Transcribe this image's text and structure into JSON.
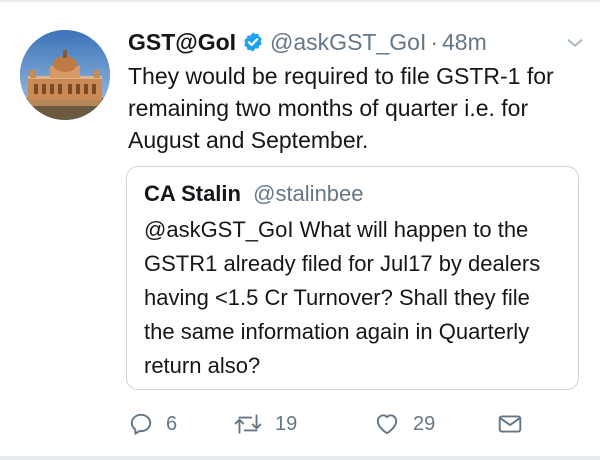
{
  "tweet": {
    "display_name": "GST@GoI",
    "handle": "@askGST_GoI",
    "separator": "·",
    "time": "48m",
    "text": "They would be required to file GSTR-1 for remaining two months of quarter i.e. for August and September.",
    "verified": true
  },
  "quoted_tweet": {
    "display_name": "CA Stalin",
    "handle": "@stalinbee",
    "text": "@askGST_GoI What will happen to the GSTR1 already filed for Jul17 by dealers having <1.5 Cr Turnover? Shall they file the same information again in Quarterly return also?"
  },
  "actions": {
    "reply": {
      "icon": "reply-icon",
      "count": "6"
    },
    "retweet": {
      "icon": "retweet-icon",
      "count": "19"
    },
    "like": {
      "icon": "heart-icon",
      "count": "29"
    },
    "share": {
      "icon": "mail-icon"
    }
  },
  "colors": {
    "text": "#14171a",
    "secondary": "#657786",
    "verified": "#1da1f2",
    "border": "#ccd6dd"
  }
}
